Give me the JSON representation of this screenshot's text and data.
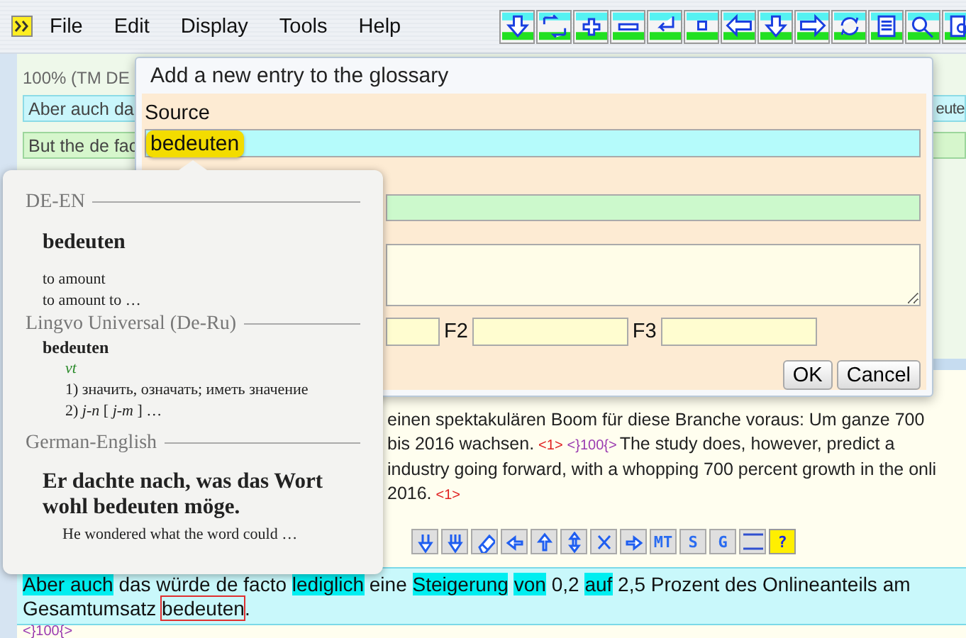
{
  "menu": {
    "items": [
      "File",
      "Edit",
      "Display",
      "Tools",
      "Help"
    ]
  },
  "editor": {
    "match_label": "100% (TM DE",
    "source_preview_left": "Aber auch da",
    "source_preview_right": "eute",
    "target_preview": "But the de fac",
    "paragraph": [
      [
        {
          "kind": "text",
          "text": "einen spektakulären Boom für diese Branche voraus: Um ganze 700"
        }
      ],
      [
        {
          "kind": "text",
          "text": "bis 2016 wachsen."
        },
        {
          "kind": "tag",
          "text": "<1>"
        },
        {
          "kind": "match_tag",
          "text": "<}100{>"
        },
        {
          "kind": "text",
          "text": "The study does, however, predict a"
        }
      ],
      [
        {
          "kind": "text",
          "text": "industry going forward, with a whopping 700 percent growth in the onli"
        }
      ],
      [
        {
          "kind": "text",
          "text": "2016."
        },
        {
          "kind": "tag",
          "text": "<1>"
        }
      ]
    ],
    "text_buttons": [
      "MT",
      "S",
      "G"
    ],
    "help_button": "?",
    "active_segment": [
      {
        "kind": "match",
        "text": "Aber auch"
      },
      {
        "kind": "plain",
        "text": "das würde de facto",
        "attached": false
      },
      {
        "kind": "match",
        "text": "lediglich",
        "attached": false
      },
      {
        "kind": "plain",
        "text": "eine",
        "attached": false
      },
      {
        "kind": "match",
        "text": "Steigerung",
        "attached": false
      },
      {
        "kind": "match",
        "text": "von",
        "attached": false
      },
      {
        "kind": "plain",
        "text": "0,2",
        "attached": false
      },
      {
        "kind": "match",
        "text": "auf",
        "attached": false
      },
      {
        "kind": "plain",
        "text": "2,5 Prozent des Onlineanteils am Gesamtumsatz",
        "attached": false
      },
      {
        "kind": "selected",
        "text": "bedeuten",
        "attached": false
      },
      {
        "kind": "plain",
        "text": ".",
        "attached": true
      }
    ],
    "closing_tag": "<}100{>"
  },
  "dialog": {
    "title": "Add a new entry to the glossary",
    "source_label": "Source",
    "source_value": "bedeuten",
    "field_labels": [
      "F2",
      "F3"
    ],
    "buttons": [
      "OK",
      "Cancel"
    ]
  },
  "dictionary_popup": {
    "sections": [
      {
        "kind": "translations",
        "source": "DE-EN",
        "headword": "bedeuten",
        "lines": [
          "to amount",
          "to amount to …"
        ]
      },
      {
        "kind": "senses",
        "source": "Lingvo Universal (De-Ru)",
        "headword": "bedeuten",
        "part_of_speech": "vt",
        "senses": [
          {
            "number": "1)",
            "text": "значить, означать; иметь значение"
          },
          {
            "number": "2)",
            "text": "*j-n* [ *j-m* ] …"
          }
        ]
      },
      {
        "kind": "example",
        "source": "German-English",
        "example": "Er dachte nach, was das Wort wohl bedeuten möge.",
        "translation": "He wondered what the word could …"
      }
    ]
  }
}
